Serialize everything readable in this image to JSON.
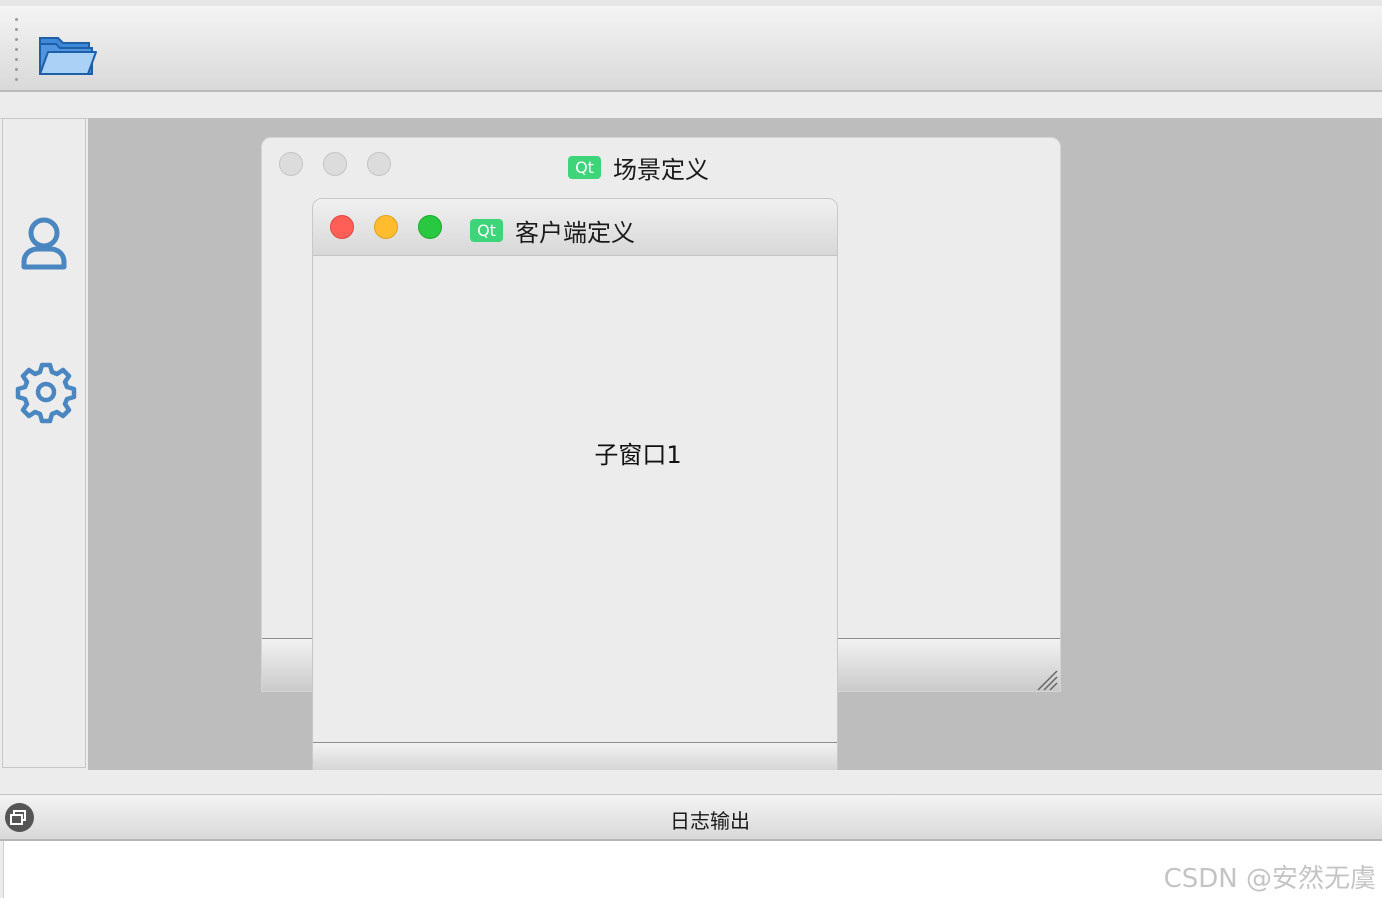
{
  "toolbar": {
    "open_icon": "folder-open-icon"
  },
  "sidebar": {
    "items": [
      {
        "icon": "user-icon"
      },
      {
        "icon": "gear-icon"
      }
    ]
  },
  "windows": {
    "scene": {
      "title": "场景定义",
      "qt_badge": "Qt"
    },
    "client": {
      "title": "客户端定义",
      "qt_badge": "Qt",
      "content_label": "子窗口1"
    }
  },
  "dock": {
    "title": "日志输出",
    "float_icon": "restore-icon"
  },
  "watermark": "CSDN @安然无虞",
  "colors": {
    "icon_blue": "#4a86c0",
    "qt_green": "#3ed47a",
    "close_red": "#ff5f57",
    "minimize_yellow": "#febc2e",
    "zoom_green": "#28c840",
    "mdi_background": "#bdbdbd"
  }
}
